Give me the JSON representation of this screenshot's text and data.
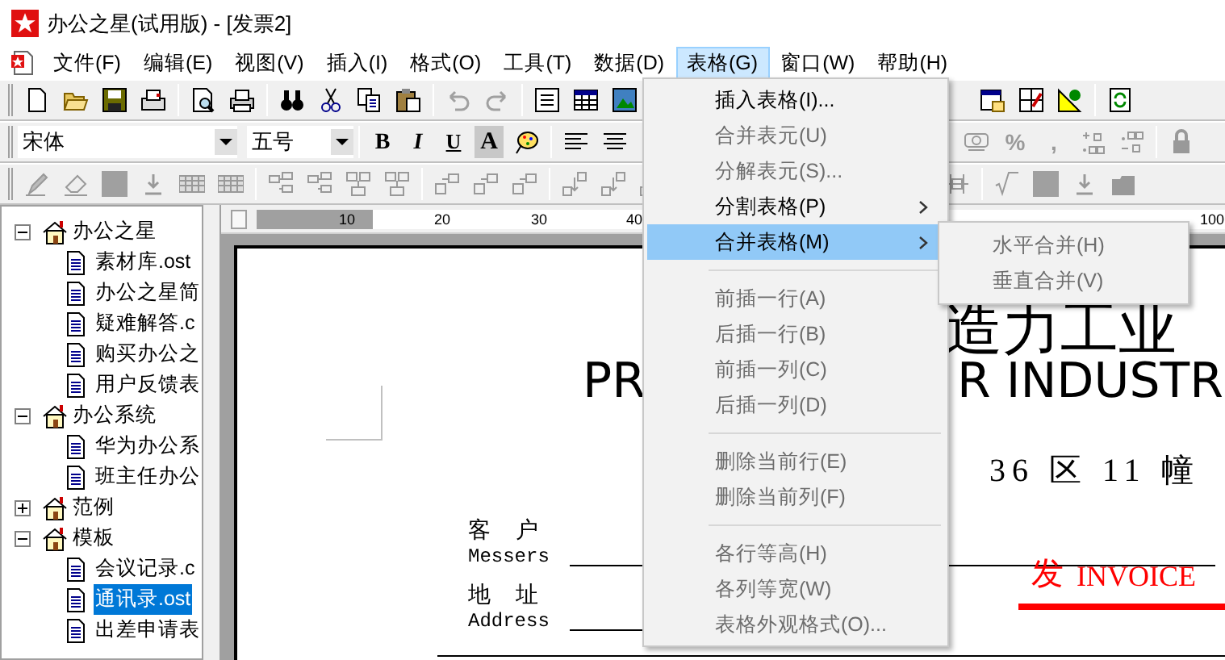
{
  "window": {
    "title": "办公之星(试用版) - [发票2]"
  },
  "menubar": [
    {
      "label": "文件(F)",
      "selected": false
    },
    {
      "label": "编辑(E)",
      "selected": false
    },
    {
      "label": "视图(V)",
      "selected": false
    },
    {
      "label": "插入(I)",
      "selected": false
    },
    {
      "label": "格式(O)",
      "selected": false
    },
    {
      "label": "工具(T)",
      "selected": false
    },
    {
      "label": "数据(D)",
      "selected": false
    },
    {
      "label": "表格(G)",
      "selected": true
    },
    {
      "label": "窗口(W)",
      "selected": false
    },
    {
      "label": "帮助(H)",
      "selected": false
    }
  ],
  "format_toolbar": {
    "font": "宋体",
    "size": "五号",
    "style_buttons": [
      {
        "kind": "bold",
        "label": "B"
      },
      {
        "kind": "italic",
        "label": "I"
      },
      {
        "kind": "underline",
        "label": "U"
      },
      {
        "kind": "shade",
        "label": "A"
      }
    ],
    "number_buttons": [
      {
        "label": "%",
        "disabled": true
      },
      {
        "label": ",",
        "disabled": true
      }
    ]
  },
  "tree": [
    {
      "label": "办公之星",
      "expanded": true,
      "children": [
        {
          "label": "素材库.ost",
          "selected": false
        },
        {
          "label": "办公之星简",
          "selected": false
        },
        {
          "label": "疑难解答.c",
          "selected": false
        },
        {
          "label": "购买办公之",
          "selected": false
        },
        {
          "label": "用户反馈表",
          "selected": false
        }
      ]
    },
    {
      "label": "办公系统",
      "expanded": true,
      "children": [
        {
          "label": "华为办公系",
          "selected": false
        },
        {
          "label": "班主任办公",
          "selected": false
        }
      ]
    },
    {
      "label": "范例",
      "expanded": false
    },
    {
      "label": "模板",
      "expanded": true,
      "children": [
        {
          "label": "会议记录.c",
          "selected": false
        },
        {
          "label": "通讯录.ost",
          "selected": true
        },
        {
          "label": "出差申请表",
          "selected": false
        }
      ]
    }
  ],
  "ruler": {
    "ticks": [
      "10",
      "20",
      "30",
      "40",
      "100"
    ]
  },
  "document": {
    "title_cn": "造力工业",
    "title_en_left": "PR",
    "title_en_right": "R INDUSTR",
    "address": "36 区 11 幢",
    "client_cn": "客 户",
    "client_en": "Messers",
    "address_cn": "地 址",
    "address_en": "Address",
    "invoice_cn": "发",
    "invoice_en": "INVOICE"
  },
  "table_menu": {
    "items": [
      {
        "kind": "item",
        "label": "插入表格(I)...",
        "disabled": false,
        "submenu": false,
        "selected": false
      },
      {
        "kind": "item",
        "label": "合并表元(U)",
        "disabled": true,
        "submenu": false,
        "selected": false
      },
      {
        "kind": "item",
        "label": "分解表元(S)...",
        "disabled": true,
        "submenu": false,
        "selected": false
      },
      {
        "kind": "item",
        "label": "分割表格(P)",
        "disabled": false,
        "submenu": true,
        "selected": false
      },
      {
        "kind": "item",
        "label": "合并表格(M)",
        "disabled": false,
        "submenu": true,
        "selected": true
      },
      {
        "kind": "separator"
      },
      {
        "kind": "item",
        "label": "前插一行(A)",
        "disabled": true,
        "submenu": false,
        "selected": false
      },
      {
        "kind": "item",
        "label": "后插一行(B)",
        "disabled": true,
        "submenu": false,
        "selected": false
      },
      {
        "kind": "item",
        "label": "前插一列(C)",
        "disabled": true,
        "submenu": false,
        "selected": false
      },
      {
        "kind": "item",
        "label": "后插一列(D)",
        "disabled": true,
        "submenu": false,
        "selected": false
      },
      {
        "kind": "separator"
      },
      {
        "kind": "item",
        "label": "删除当前行(E)",
        "disabled": true,
        "submenu": false,
        "selected": false
      },
      {
        "kind": "item",
        "label": "删除当前列(F)",
        "disabled": true,
        "submenu": false,
        "selected": false
      },
      {
        "kind": "separator"
      },
      {
        "kind": "item",
        "label": "各行等高(H)",
        "disabled": true,
        "submenu": false,
        "selected": false
      },
      {
        "kind": "item",
        "label": "各列等宽(W)",
        "disabled": true,
        "submenu": false,
        "selected": false
      },
      {
        "kind": "item",
        "label": "表格外观格式(O)...",
        "disabled": true,
        "submenu": false,
        "selected": false
      }
    ]
  },
  "submenu": {
    "items": [
      {
        "label": "水平合并(H)",
        "disabled": true
      },
      {
        "label": "垂直合并(V)",
        "disabled": true
      }
    ]
  }
}
